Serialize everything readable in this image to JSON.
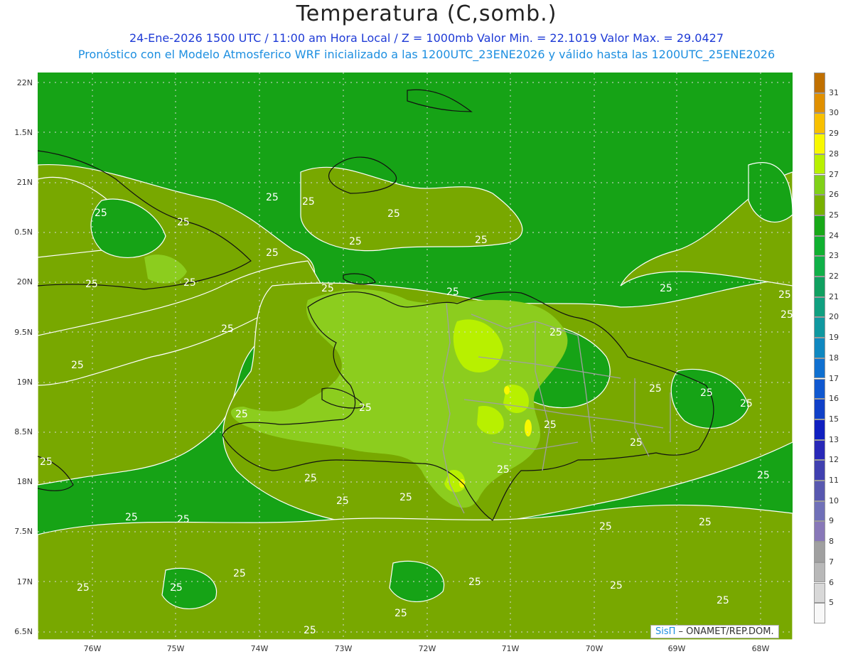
{
  "header": {
    "title": "Temperatura (C,somb.)",
    "subtitle_1": "24-Ene-2026 1500 UTC / 11:00 am Hora Local / Z = 1000mb   Valor Min. = 22.1019   Valor Max. = 29.0427",
    "subtitle_2": "Pronóstico con el Modelo Atmosferico WRF inicializado a las 1200UTC_23ENE2026 y válido hasta las  1200UTC_25ENE2026"
  },
  "axes": {
    "lat_labels": [
      "22N",
      "1.5N",
      "21N",
      "0.5N",
      "20N",
      "9.5N",
      "19N",
      "8.5N",
      "18N",
      "7.5N",
      "17N",
      "6.5N"
    ],
    "lon_labels": [
      "76W",
      "75W",
      "74W",
      "73W",
      "72W",
      "71W",
      "70W",
      "69W",
      "68W"
    ]
  },
  "contour_label": "25",
  "colorbar": {
    "labels": [
      "31",
      "30",
      "29",
      "28",
      "27",
      "26",
      "25",
      "24",
      "23",
      "22",
      "21",
      "20",
      "19",
      "18",
      "17",
      "16",
      "15",
      "13",
      "12",
      "11",
      "10",
      "9",
      "8",
      "7",
      "6",
      "5"
    ],
    "colors": [
      "#c07000",
      "#e09000",
      "#f8c000",
      "#f8f800",
      "#b8f000",
      "#80d018",
      "#78b000",
      "#18a818",
      "#10b030",
      "#10b048",
      "#10a060",
      "#10a080",
      "#1098a0",
      "#1088c0",
      "#1070d0",
      "#1058d0",
      "#1040c8",
      "#1020c0",
      "#2828b8",
      "#4040b0",
      "#5858b0",
      "#7070b8",
      "#8878b8",
      "#a0a0a0",
      "#b8b8b8",
      "#d8d8d8",
      "#f8f8f8"
    ]
  },
  "credit": {
    "brand": "SisΠ",
    "text": " – ONAMET/REP.DOM."
  }
}
